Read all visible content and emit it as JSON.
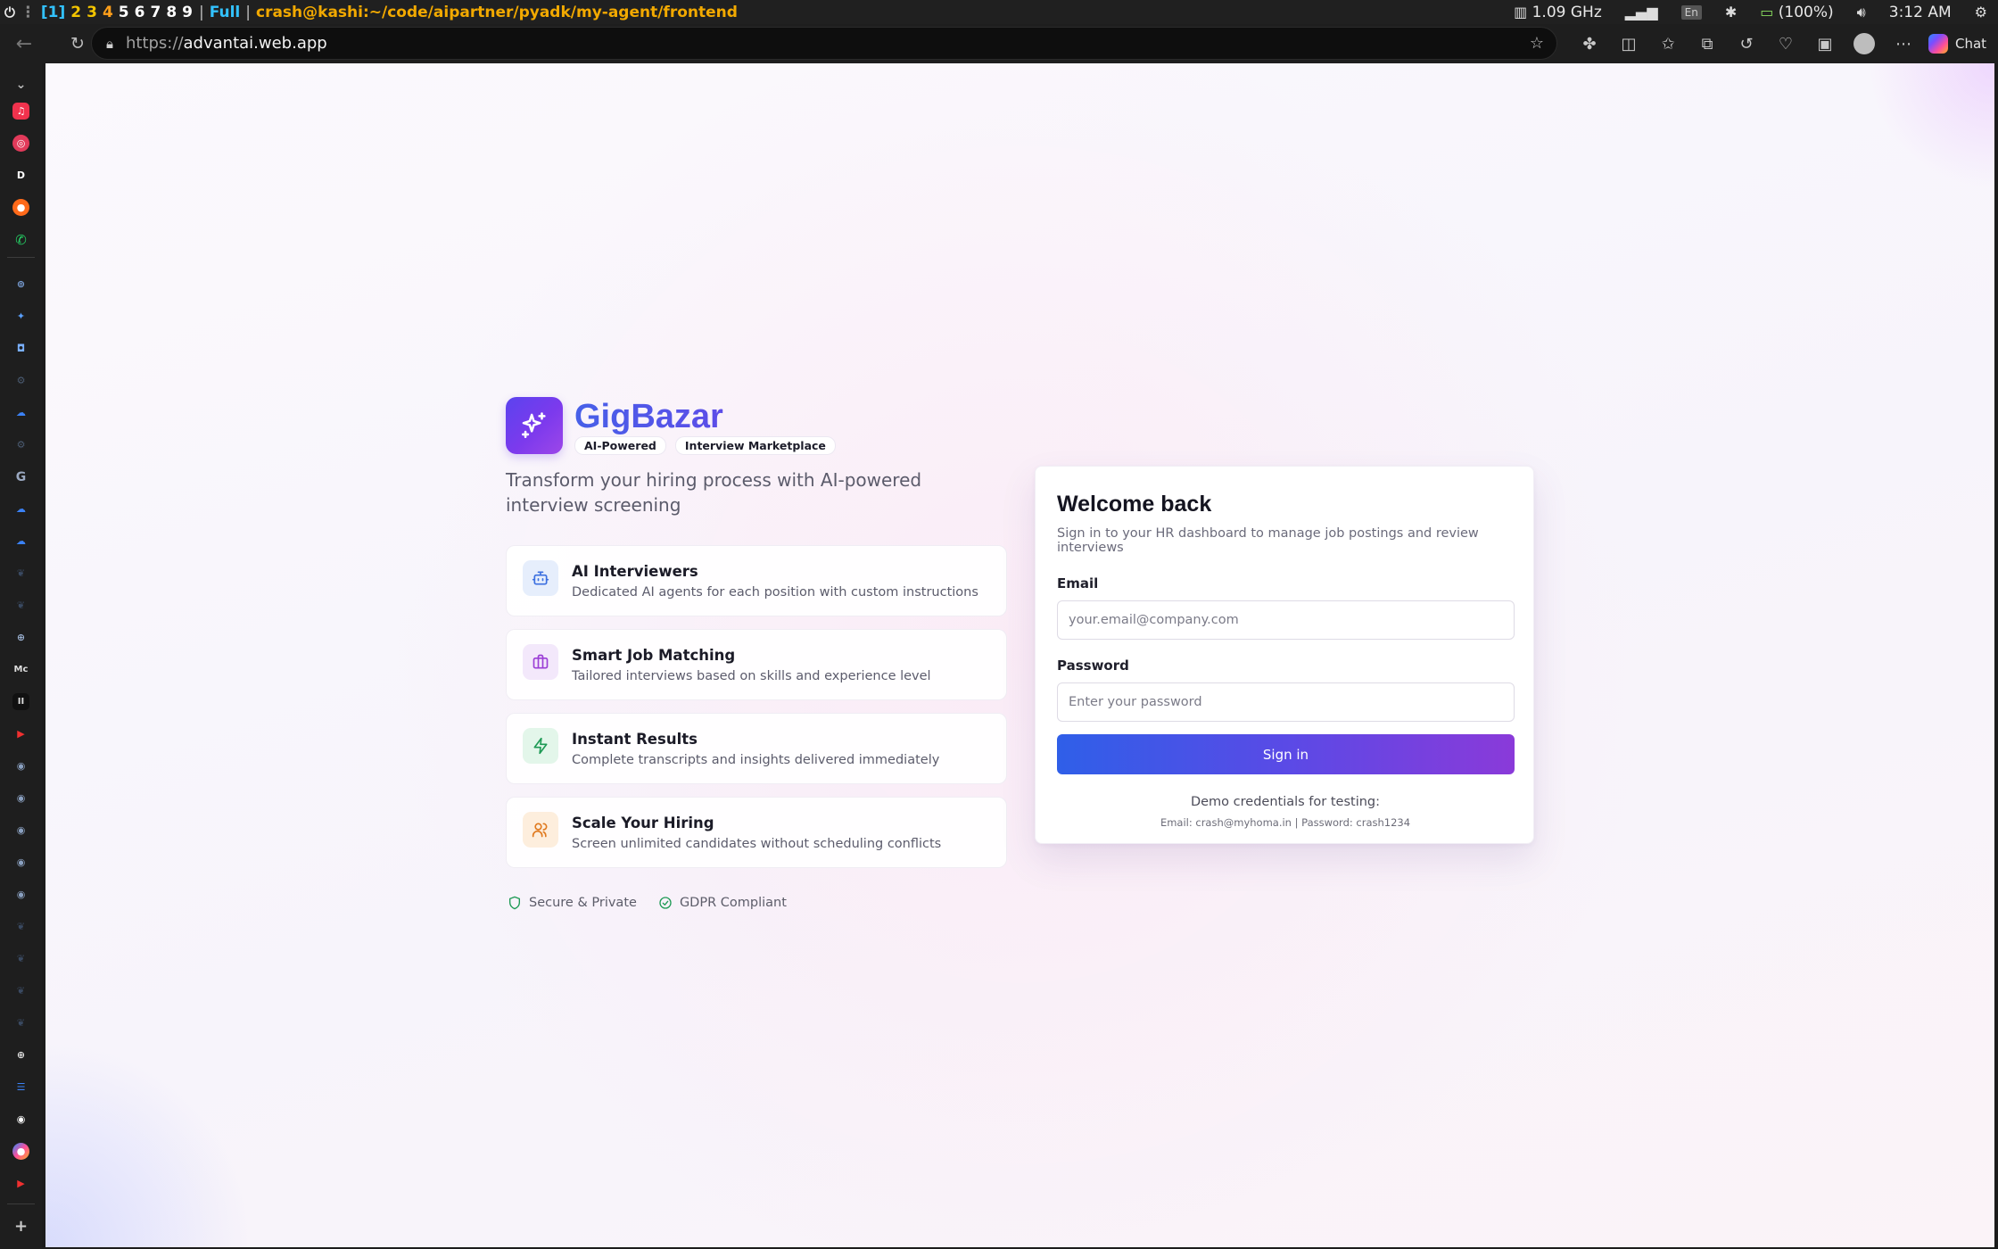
{
  "system_bar": {
    "workspaces": [
      "[1]",
      "2",
      "3",
      "4",
      "5",
      "6",
      "7",
      "8",
      "9"
    ],
    "mode": "Full",
    "separator": "|",
    "window_title": "crash@kashi:~/code/aipartner/pyadk/my-agent/frontend",
    "cpu": "1.09 GHz",
    "language": "En",
    "battery": "(100%)",
    "time": "3:12 AM"
  },
  "browser": {
    "url_protocol": "https://",
    "url_host": "advantai.web.app",
    "chat_label": "Chat"
  },
  "brand": {
    "name": "GigBazar",
    "badges": [
      "AI-Powered",
      "Interview Marketplace"
    ],
    "tagline": "Transform your hiring process with AI-powered interview screening"
  },
  "features": [
    {
      "title": "AI Interviewers",
      "description": "Dedicated AI agents for each position with custom instructions",
      "icon": "bot-icon",
      "color": "#3b6fe0",
      "bg": "#e6eefc"
    },
    {
      "title": "Smart Job Matching",
      "description": "Tailored interviews based on skills and experience level",
      "icon": "briefcase-icon",
      "color": "#9b3fd6",
      "bg": "#f3e8fb"
    },
    {
      "title": "Instant Results",
      "description": "Complete transcripts and insights delivered immediately",
      "icon": "bolt-icon",
      "color": "#1e9a55",
      "bg": "#e3f6ea"
    },
    {
      "title": "Scale Your Hiring",
      "description": "Screen unlimited candidates without scheduling conflicts",
      "icon": "users-icon",
      "color": "#e07a1f",
      "bg": "#fdeedd"
    }
  ],
  "trust": [
    {
      "label": "Secure & Private",
      "icon": "shield-icon"
    },
    {
      "label": "GDPR Compliant",
      "icon": "check-circle-icon"
    }
  ],
  "login": {
    "title": "Welcome back",
    "subtitle": "Sign in to your HR dashboard to manage job postings and review interviews",
    "email_label": "Email",
    "email_placeholder": "your.email@company.com",
    "email_value": "",
    "password_label": "Password",
    "password_placeholder": "Enter your password",
    "password_value": "",
    "submit_label": "Sign in",
    "demo_heading": "Demo credentials for testing:",
    "demo_credentials": "Email: crash@myhoma.in | Password: crash1234"
  },
  "colors": {
    "accent_start": "#2f5fe8",
    "accent_end": "#8a3ad9",
    "brand_purple": "#6d3fe8"
  }
}
